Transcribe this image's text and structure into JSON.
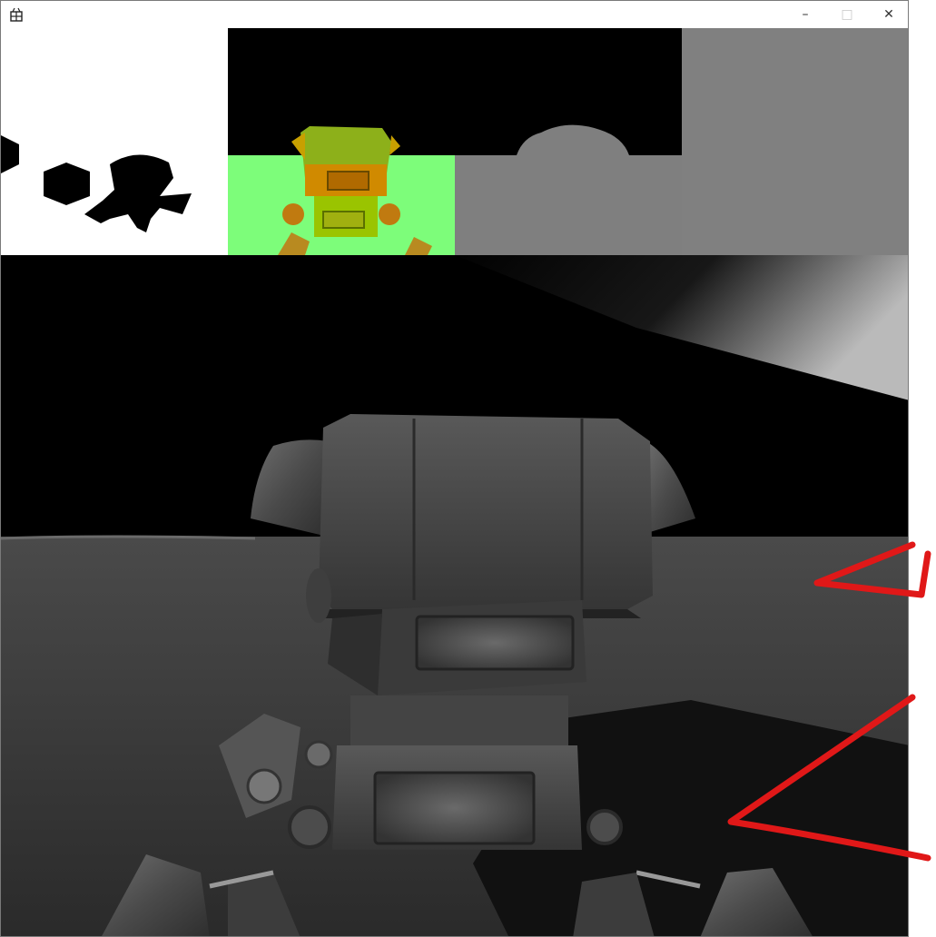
{
  "window": {
    "title": "",
    "icons": {
      "app": "app-icon",
      "minimize": "minimize-icon",
      "maximize": "maximize-icon",
      "close": "close-icon"
    },
    "controls": {
      "minimize": "–",
      "maximize": "□",
      "close": "✕"
    }
  },
  "viewport": {
    "description_items": [
      "mask-buffer-thumbnail",
      "normal-buffer-thumbnail",
      "depth-buffer-thumbnail",
      "shadow-map-thumbnail",
      "robot-render"
    ]
  },
  "colors": {
    "titlebar": "#ffffff",
    "viewport_bg": "#000000",
    "floor": "#3a3a3a",
    "normal_green": "#7dfd7a",
    "depth_gray": "#808080",
    "annotation_red": "#e01818"
  }
}
